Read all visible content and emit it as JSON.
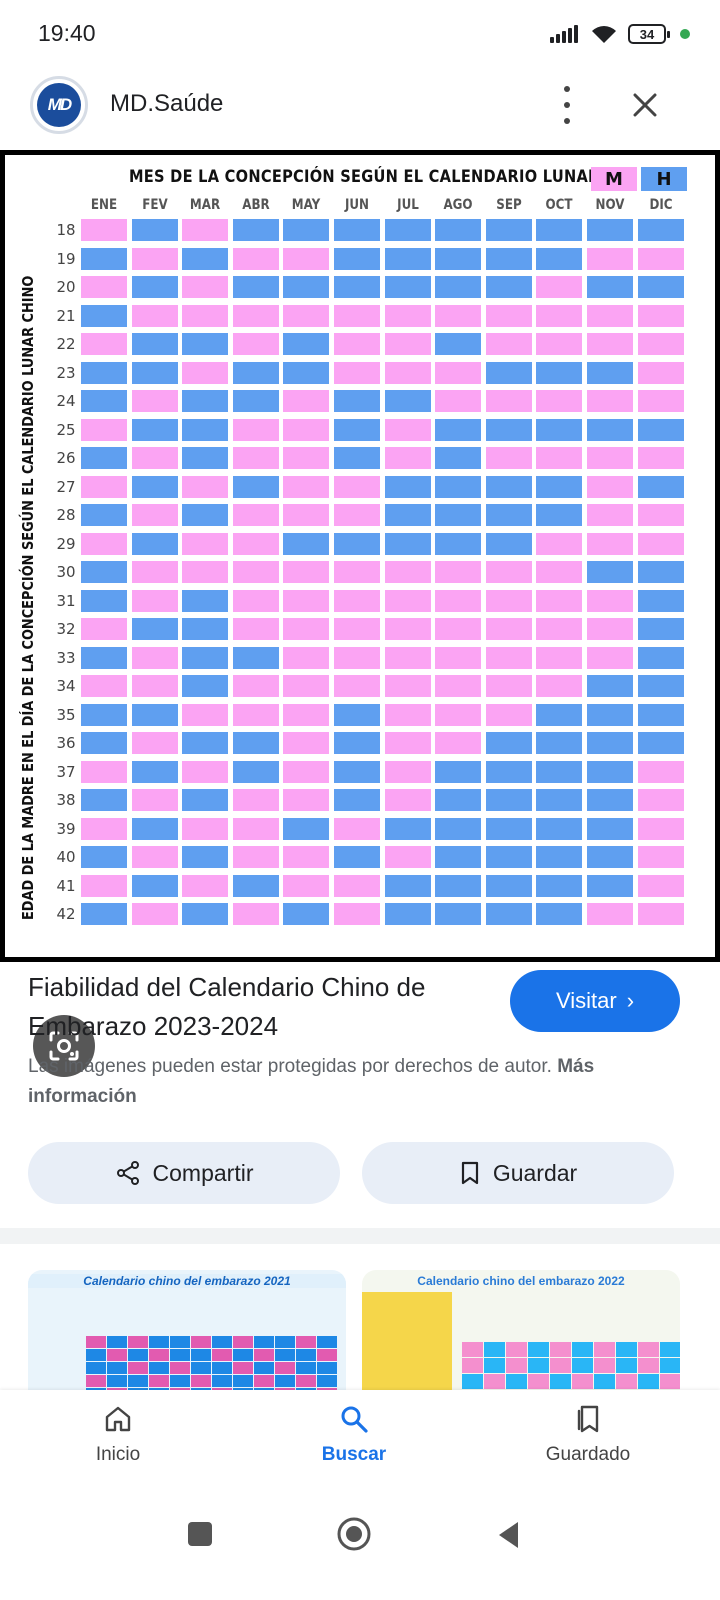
{
  "status_bar": {
    "time": "19:40",
    "battery": "34"
  },
  "header": {
    "site_name": "MD.Saúde",
    "logo_text": "MD"
  },
  "chart": {
    "title": "MES DE LA CONCEPCIÓN SEGÚN EL CALENDARIO LUNAR",
    "legend": [
      {
        "label": "M",
        "color": "#fba4f3"
      },
      {
        "label": "H",
        "color": "#5f9ff0"
      }
    ],
    "y_axis_label": "EDAD DE LA MADRE EN EL DÍA DE LA CONCEPCIÓN SEGÚN EL CALENDARIO LUNAR CHINO",
    "months": [
      "ENE",
      "FEV",
      "MAR",
      "ABR",
      "MAY",
      "JUN",
      "JUL",
      "AGO",
      "SEP",
      "OCT",
      "NOV",
      "DIC"
    ],
    "ages": [
      "18",
      "19",
      "20",
      "21",
      "22",
      "23",
      "24",
      "25",
      "26",
      "27",
      "28",
      "29",
      "30",
      "31",
      "32",
      "33",
      "34",
      "35",
      "36",
      "37",
      "38",
      "39",
      "40",
      "41",
      "42"
    ],
    "colors": {
      "M": "#fba4f3",
      "H": "#5f9ff0"
    }
  },
  "chart_data": {
    "type": "heatmap",
    "title": "MES DE LA CONCEPCIÓN SEGÚN EL CALENDARIO LUNAR",
    "ylabel": "EDAD DE LA MADRE EN EL DÍA DE LA CONCEPCIÓN SEGÚN EL CALENDARIO LUNAR CHINO",
    "x": [
      "ENE",
      "FEV",
      "MAR",
      "ABR",
      "MAY",
      "JUN",
      "JUL",
      "AGO",
      "SEP",
      "OCT",
      "NOV",
      "DIC"
    ],
    "y": [
      "18",
      "19",
      "20",
      "21",
      "22",
      "23",
      "24",
      "25",
      "26",
      "27",
      "28",
      "29",
      "30",
      "31",
      "32",
      "33",
      "34",
      "35",
      "36",
      "37",
      "38",
      "39",
      "40",
      "41",
      "42"
    ],
    "legend": [
      "M",
      "H"
    ],
    "values": [
      [
        "M",
        "H",
        "M",
        "H",
        "H",
        "H",
        "H",
        "H",
        "H",
        "H",
        "H",
        "H"
      ],
      [
        "H",
        "M",
        "H",
        "M",
        "M",
        "H",
        "H",
        "H",
        "H",
        "H",
        "M",
        "M"
      ],
      [
        "M",
        "H",
        "M",
        "H",
        "H",
        "H",
        "H",
        "H",
        "H",
        "M",
        "H",
        "H"
      ],
      [
        "H",
        "M",
        "M",
        "M",
        "M",
        "M",
        "M",
        "M",
        "M",
        "M",
        "M",
        "M"
      ],
      [
        "M",
        "H",
        "H",
        "M",
        "H",
        "M",
        "M",
        "H",
        "M",
        "M",
        "M",
        "M"
      ],
      [
        "H",
        "H",
        "M",
        "H",
        "H",
        "M",
        "M",
        "M",
        "H",
        "H",
        "H",
        "M"
      ],
      [
        "H",
        "M",
        "H",
        "H",
        "M",
        "H",
        "H",
        "M",
        "M",
        "M",
        "M",
        "M"
      ],
      [
        "M",
        "H",
        "H",
        "M",
        "M",
        "H",
        "M",
        "H",
        "H",
        "H",
        "H",
        "H"
      ],
      [
        "H",
        "M",
        "H",
        "M",
        "M",
        "H",
        "M",
        "H",
        "M",
        "M",
        "M",
        "M"
      ],
      [
        "M",
        "H",
        "M",
        "H",
        "M",
        "M",
        "H",
        "H",
        "H",
        "H",
        "M",
        "H"
      ],
      [
        "H",
        "M",
        "H",
        "M",
        "M",
        "M",
        "H",
        "H",
        "H",
        "H",
        "M",
        "M"
      ],
      [
        "M",
        "H",
        "M",
        "M",
        "H",
        "H",
        "H",
        "H",
        "H",
        "M",
        "M",
        "M"
      ],
      [
        "H",
        "M",
        "M",
        "M",
        "M",
        "M",
        "M",
        "M",
        "M",
        "M",
        "H",
        "H"
      ],
      [
        "H",
        "M",
        "H",
        "M",
        "M",
        "M",
        "M",
        "M",
        "M",
        "M",
        "M",
        "H"
      ],
      [
        "M",
        "H",
        "H",
        "M",
        "M",
        "M",
        "M",
        "M",
        "M",
        "M",
        "M",
        "H"
      ],
      [
        "H",
        "M",
        "H",
        "H",
        "M",
        "M",
        "M",
        "M",
        "M",
        "M",
        "M",
        "H"
      ],
      [
        "M",
        "M",
        "H",
        "M",
        "M",
        "M",
        "M",
        "M",
        "M",
        "M",
        "H",
        "H"
      ],
      [
        "H",
        "H",
        "M",
        "M",
        "M",
        "H",
        "M",
        "M",
        "M",
        "H",
        "H",
        "H"
      ],
      [
        "H",
        "M",
        "H",
        "H",
        "M",
        "H",
        "M",
        "M",
        "H",
        "H",
        "H",
        "H"
      ],
      [
        "M",
        "H",
        "M",
        "H",
        "M",
        "H",
        "M",
        "H",
        "H",
        "H",
        "H",
        "M"
      ],
      [
        "H",
        "M",
        "H",
        "M",
        "M",
        "H",
        "M",
        "H",
        "H",
        "H",
        "H",
        "M"
      ],
      [
        "M",
        "H",
        "M",
        "M",
        "H",
        "M",
        "H",
        "H",
        "H",
        "H",
        "H",
        "M"
      ],
      [
        "H",
        "M",
        "H",
        "M",
        "M",
        "H",
        "M",
        "H",
        "H",
        "H",
        "H",
        "M"
      ],
      [
        "M",
        "H",
        "M",
        "H",
        "M",
        "M",
        "H",
        "H",
        "H",
        "H",
        "H",
        "M"
      ],
      [
        "H",
        "M",
        "H",
        "M",
        "H",
        "M",
        "H",
        "H",
        "H",
        "H",
        "M",
        "M"
      ]
    ]
  },
  "result": {
    "title": "Fiabilidad del Calendario Chino de Embarazo 2023-2024",
    "visit_label": "Visitar",
    "copyright_text": "Las imágenes pueden estar protegidas por derechos de autor.",
    "more_info": "Más información"
  },
  "actions": {
    "share_label": "Compartir",
    "save_label": "Guardar"
  },
  "related": [
    {
      "title": "Calendario chino del embarazo 2021"
    },
    {
      "title": "Calendario chino del embarazo 2022"
    }
  ],
  "bottom_nav": [
    {
      "label": "Inicio",
      "icon": "home-icon"
    },
    {
      "label": "Buscar",
      "icon": "search-icon"
    },
    {
      "label": "Guardado",
      "icon": "saved-icon"
    }
  ]
}
